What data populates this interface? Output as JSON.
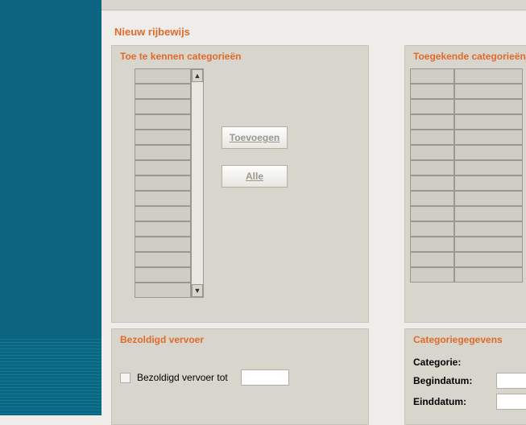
{
  "page_title": "Nieuw rijbewijs",
  "panels": {
    "toetekennen": {
      "title": "Toe te kennen categorieën"
    },
    "toegekend": {
      "title": "Toegekende categorieën"
    },
    "bezoldigd": {
      "title": "Bezoldigd vervoer"
    },
    "catgeg": {
      "title": "Categoriegegevens"
    }
  },
  "buttons": {
    "toevoegen": "Toevoegen",
    "alle": "Alle"
  },
  "bezoldigd": {
    "checkbox_label": "Bezoldigd vervoer tot",
    "value": ""
  },
  "catgeg": {
    "categorie_label": "Categorie:",
    "begindatum_label": "Begindatum:",
    "einddatum_label": "Einddatum:",
    "begindatum_value": "",
    "einddatum_value": ""
  },
  "icons": {
    "up": "▲",
    "down": "▼"
  }
}
